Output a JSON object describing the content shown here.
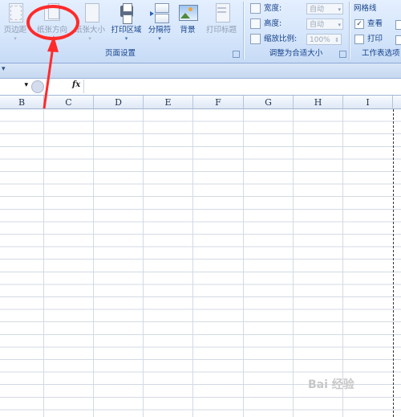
{
  "ribbon": {
    "page_setup": {
      "buttons": [
        {
          "label": "页边距",
          "enabled": false
        },
        {
          "label": "纸张方向",
          "enabled": false
        },
        {
          "label": "纸张大小",
          "enabled": false
        },
        {
          "label": "打印区域",
          "enabled": true
        },
        {
          "label": "分隔符",
          "enabled": true
        },
        {
          "label": "背景",
          "enabled": true
        },
        {
          "label": "打印标题",
          "enabled": false
        }
      ],
      "group_label": "页面设置"
    },
    "scale_to_fit": {
      "width_label": "宽度:",
      "width_value": "自动",
      "height_label": "高度:",
      "height_value": "自动",
      "scale_label": "缩放比例:",
      "scale_value": "100%",
      "group_label": "调整为合适大小"
    },
    "sheet_options": {
      "gridlines_title": "网格线",
      "view_label": "查看",
      "view_checked": true,
      "print_label": "打印",
      "print_checked": false,
      "group_label": "工作表选项"
    }
  },
  "quick_access": {
    "glyph": "▾"
  },
  "formula_bar": {
    "fx": "fx",
    "name_arrow": "▾"
  },
  "sheet": {
    "columns": [
      "B",
      "C",
      "D",
      "E",
      "F",
      "G",
      "H",
      "I"
    ]
  },
  "annotation": {
    "color": "#ff2b2b"
  },
  "watermark": {
    "text": "Bai 经验"
  }
}
